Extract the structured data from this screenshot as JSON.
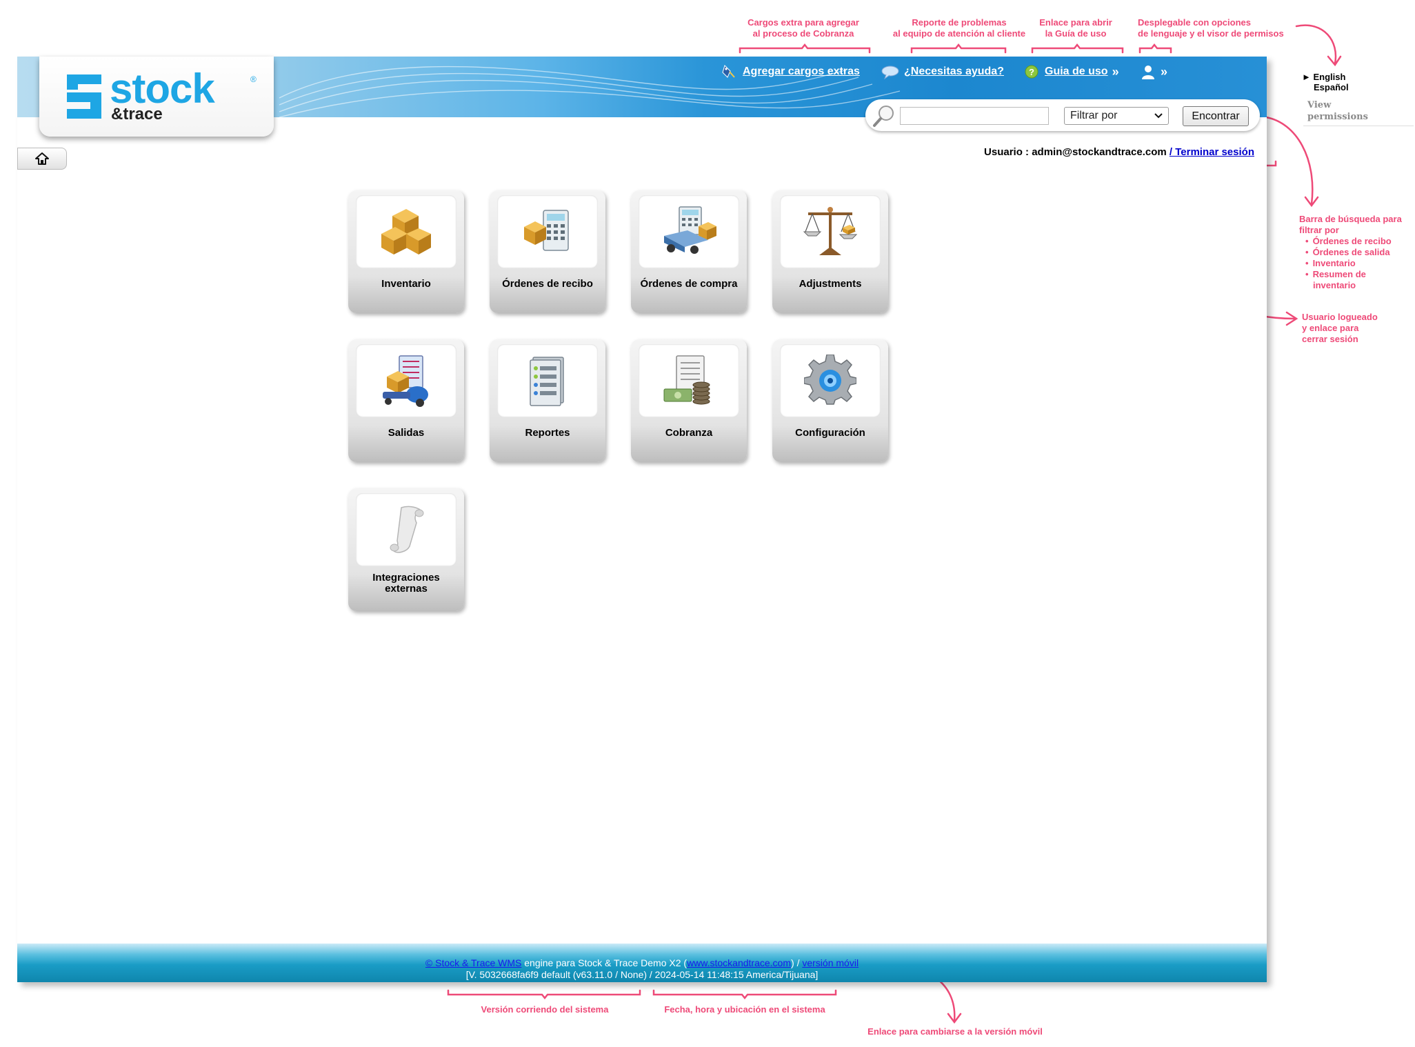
{
  "annotations": {
    "cargos": "Cargos extra para agregar\nal proceso de Cobranza",
    "reporte": "Reporte de problemas\nal equipo de atención al cliente",
    "enlace_guia": "Enlace para abrir\nla Guía de uso",
    "desplegable": "Desplegable con opciones\nde lenguaje y el visor de permisos",
    "busqueda_title": "Barra de búsqueda para\nfiltrar por",
    "busqueda_items": [
      "Órdenes de recibo",
      "Órdenes de salida",
      "Inventario",
      "Resumen de\ninventario"
    ],
    "usuario": "Usuario logueado\ny enlace para\ncerrar sesión",
    "version": "Versión corriendo del sistema",
    "fecha": "Fecha, hora y ubicación en el sistema",
    "movil": "Enlace para cambiarse a la versión móvil"
  },
  "logo": {
    "word": "stock",
    "reg": "®",
    "sub": "&trace"
  },
  "header": {
    "agregar_cargos": "Agregar cargos extras",
    "necesitas_ayuda": "¿Necesitas ayuda?",
    "guia_de_uso": "Guia de uso",
    "raquo": "»"
  },
  "search": {
    "placeholder": "",
    "filter_label": "Filtrar por",
    "button": "Encontrar"
  },
  "user": {
    "prefix": "Usuario : admin@stockandtrace.com ",
    "logout": "/ Terminar sesión"
  },
  "modules": [
    {
      "label": "Inventario",
      "icon": "boxes-icon"
    },
    {
      "label": "Órdenes de recibo",
      "icon": "receipt-order-icon"
    },
    {
      "label": "Órdenes de compra",
      "icon": "purchase-order-truck-icon"
    },
    {
      "label": "Adjustments",
      "icon": "scale-icon"
    },
    {
      "label": "Salidas",
      "icon": "shipment-icon"
    },
    {
      "label": "Reportes",
      "icon": "reports-icon"
    },
    {
      "label": "Cobranza",
      "icon": "billing-money-icon"
    },
    {
      "label": "Configuración",
      "icon": "gear-icon"
    },
    {
      "label": "Integraciones externas",
      "icon": "scroll-icon"
    }
  ],
  "footer": {
    "copyright_link": "© Stock & Trace WMS",
    "engine_text": " engine para Stock & Trace Demo X2 (",
    "site_link": "www.stockandtrace.com",
    "sep": ") / ",
    "mobile_link": "versión móvil",
    "version_line": "[V. 5032668fa6f9 default (v63.11.0 / None) / 2024-05-14 11:48:15 America/Tijuana]"
  },
  "right_menu": {
    "arrow": "►",
    "english": "English",
    "espanol": "Español",
    "permissions": "View\npermissions"
  },
  "colors": {
    "accent_pink": "#ee4a78",
    "banner_blue": "#1c87cf",
    "logo_blue": "#1ea6e4",
    "link_blue": "#0000cc"
  }
}
